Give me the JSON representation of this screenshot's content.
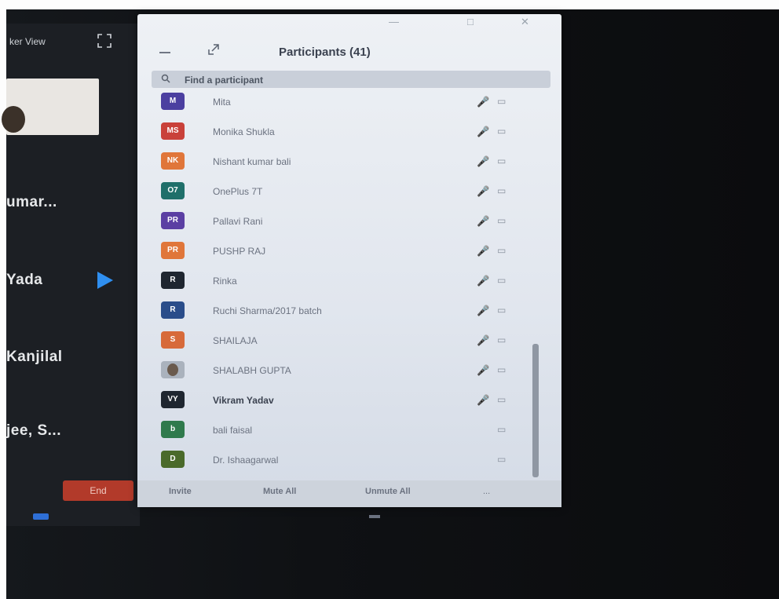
{
  "gallery": {
    "header_label": "ker View",
    "participants": [
      {
        "name": "umar..."
      },
      {
        "name": "Yada"
      },
      {
        "name": "Kanjilal"
      },
      {
        "name": "jee, S..."
      }
    ],
    "end_label": "End"
  },
  "panel": {
    "title": "Participants (41)",
    "search_placeholder": "Find a participant",
    "participants": [
      {
        "initials": "M",
        "name": "Mita",
        "color": "#4b3fa0"
      },
      {
        "initials": "MS",
        "name": "Monika Shukla",
        "color": "#c9413a"
      },
      {
        "initials": "NK",
        "name": "Nishant kumar bali",
        "color": "#e0763a"
      },
      {
        "initials": "O7",
        "name": "OnePlus 7T",
        "color": "#1f6f6a"
      },
      {
        "initials": "PR",
        "name": "Pallavi Rani",
        "color": "#5b3fa3"
      },
      {
        "initials": "PR",
        "name": "PUSHP RAJ",
        "color": "#e0763a"
      },
      {
        "initials": "R",
        "name": "Rinka",
        "color": "#1f2630"
      },
      {
        "initials": "R",
        "name": "Ruchi Sharma/2017 batch",
        "color": "#2a4d8a"
      },
      {
        "initials": "S",
        "name": "SHAILAJA",
        "color": "#d76a3a"
      },
      {
        "initials": "",
        "name": "SHALABH GUPTA",
        "color": "#aab2bd",
        "photo": true
      },
      {
        "initials": "VY",
        "name": "Vikram Yadav",
        "color": "#1f2630"
      },
      {
        "initials": "b",
        "name": "bali faisal",
        "color": "#2f7a4c"
      },
      {
        "initials": "D",
        "name": "Dr. Ishaagarwal",
        "color": "#4a6a2a"
      }
    ],
    "footer": {
      "invite_label": "Invite",
      "mute_all_label": "Mute All",
      "unmute_all_label": "Unmute All",
      "more_label": "..."
    }
  }
}
